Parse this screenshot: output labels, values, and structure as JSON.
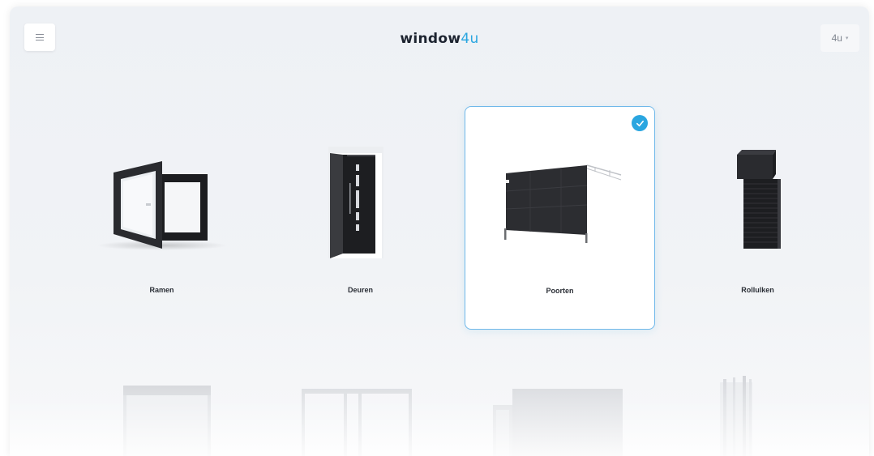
{
  "header": {
    "logo_main": "window",
    "logo_accent": "4u",
    "menu_icon": "hamburger-icon",
    "user_label": "4u",
    "user_caret": "▾"
  },
  "categories": [
    {
      "label": "Ramen",
      "icon": "window-product-image",
      "selected": false
    },
    {
      "label": "Deuren",
      "icon": "door-product-image",
      "selected": false
    },
    {
      "label": "Poorten",
      "icon": "garage-door-product-image",
      "selected": true
    },
    {
      "label": "Rollulken",
      "icon": "roller-shutter-product-image",
      "selected": false
    }
  ],
  "colors": {
    "accent": "#2aa6e0",
    "selected_border": "#6fb8ea",
    "background": "#eef1f5"
  }
}
